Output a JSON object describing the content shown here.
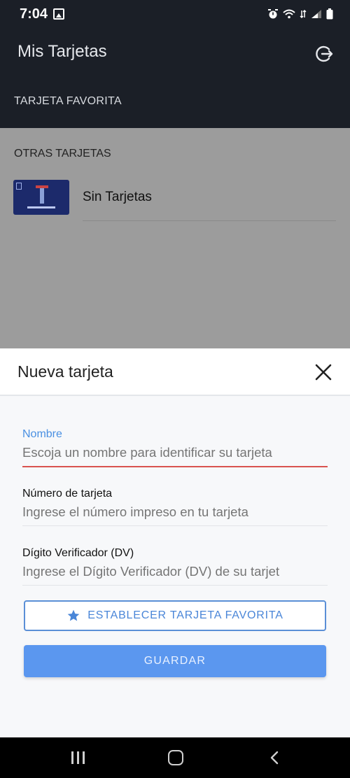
{
  "status_bar": {
    "time": "7:04"
  },
  "header": {
    "title": "Mis Tarjetas",
    "logout_icon": "logout-icon",
    "favorite_section": "TARJETA FAVORITA"
  },
  "content": {
    "others_section": "OTRAS TARJETAS",
    "cards": [
      {
        "name": "Sin Tarjetas"
      }
    ]
  },
  "sheet": {
    "title": "Nueva tarjeta",
    "close_icon": "close-icon",
    "fields": {
      "name": {
        "label": "Nombre",
        "placeholder": "Escoja un nombre para identificar su tarjeta"
      },
      "number": {
        "label": "Número de tarjeta",
        "placeholder": "Ingrese el número impreso en tu tarjeta"
      },
      "dv": {
        "label": "Dígito Verificador (DV)",
        "placeholder": "Ingrese el Dígito Verificador (DV) de su tarjet"
      }
    },
    "favorite_button": "ESTABLECER TARJETA FAVORITA",
    "save_button": "GUARDAR"
  },
  "colors": {
    "header_bg": "#1b1f27",
    "accent": "#5b97ef",
    "error_line": "#d9534f",
    "label_active": "#4a90e2"
  }
}
